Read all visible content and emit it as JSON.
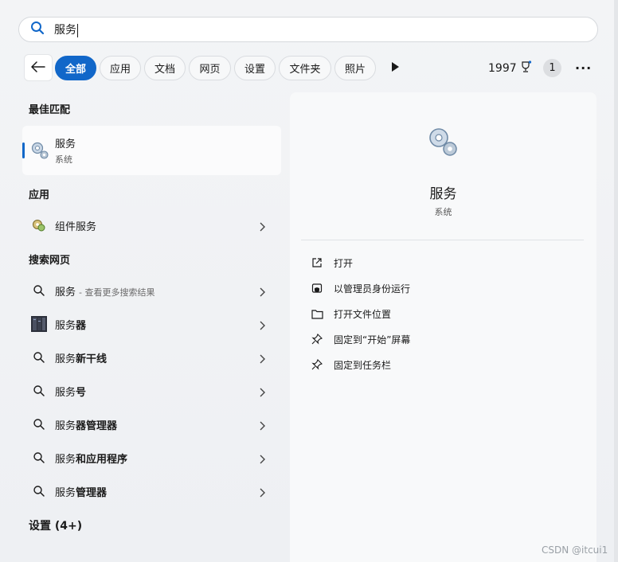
{
  "search": {
    "query": "服务"
  },
  "filters": {
    "tabs": [
      {
        "label": "全部",
        "active": true
      },
      {
        "label": "应用"
      },
      {
        "label": "文档"
      },
      {
        "label": "网页"
      },
      {
        "label": "设置"
      },
      {
        "label": "文件夹"
      },
      {
        "label": "照片"
      }
    ],
    "points": "1997",
    "notifications": "1",
    "more": "···"
  },
  "best_match": {
    "title": "最佳匹配",
    "name": "服务",
    "type": "系统"
  },
  "apps": {
    "title": "应用",
    "items": [
      {
        "label": "组件服务"
      }
    ]
  },
  "web": {
    "title": "搜索网页",
    "items": [
      {
        "prefix": "服务",
        "bold": "",
        "hint": "- 查看更多搜索结果",
        "icon": "search-icon"
      },
      {
        "prefix": "服务",
        "bold": "器",
        "hint": "",
        "icon": "server-thumbnail"
      },
      {
        "prefix": "服务",
        "bold": "新干线",
        "hint": "",
        "icon": "search-icon"
      },
      {
        "prefix": "服务",
        "bold": "号",
        "hint": "",
        "icon": "search-icon"
      },
      {
        "prefix": "服务",
        "bold": "器管理器",
        "hint": "",
        "icon": "search-icon"
      },
      {
        "prefix": "服务",
        "bold": "和应用程序",
        "hint": "",
        "icon": "search-icon"
      },
      {
        "prefix": "服务",
        "bold": "管理器",
        "hint": "",
        "icon": "search-icon"
      }
    ]
  },
  "settings": {
    "title": "设置 (4+)"
  },
  "detail": {
    "name": "服务",
    "type": "系统",
    "actions": [
      {
        "label": "打开",
        "icon": "open-external-icon"
      },
      {
        "label": "以管理员身份运行",
        "icon": "shield-icon"
      },
      {
        "label": "打开文件位置",
        "icon": "folder-icon"
      },
      {
        "label": "固定到“开始”屏幕",
        "icon": "pin-icon"
      },
      {
        "label": "固定到任务栏",
        "icon": "pin-icon"
      }
    ]
  },
  "watermark": "CSDN @itcui1",
  "colors": {
    "accent": "#1167c9"
  }
}
